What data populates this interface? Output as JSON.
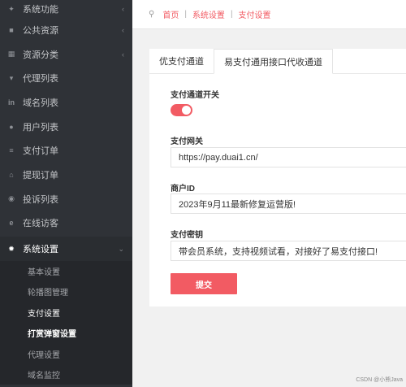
{
  "sidebar": {
    "items": [
      {
        "label": "系统功能",
        "icon": "gear-icon",
        "chevron": "‹"
      },
      {
        "label": "公共资源",
        "icon": "video-icon",
        "chevron": "‹"
      },
      {
        "label": "资源分类",
        "icon": "grid-icon",
        "chevron": "‹"
      },
      {
        "label": "代理列表",
        "icon": "shirt-icon",
        "chevron": ""
      },
      {
        "label": "域名列表",
        "icon": "linkedin-icon",
        "chevron": ""
      },
      {
        "label": "用户列表",
        "icon": "user-icon",
        "chevron": ""
      },
      {
        "label": "支付订单",
        "icon": "list-icon",
        "chevron": ""
      },
      {
        "label": "提现订单",
        "icon": "bank-icon",
        "chevron": ""
      },
      {
        "label": "投诉列表",
        "icon": "alert-icon",
        "chevron": ""
      },
      {
        "label": "在线访客",
        "icon": "ie-icon",
        "chevron": ""
      },
      {
        "label": "系统设置",
        "icon": "settings-icon",
        "chevron": "⌄"
      }
    ],
    "submenu": [
      {
        "label": "基本设置"
      },
      {
        "label": "轮播图管理"
      },
      {
        "label": "支付设置"
      },
      {
        "label": "打赏弹窗设置"
      },
      {
        "label": "代理设置"
      },
      {
        "label": "域名监控"
      }
    ]
  },
  "breadcrumb": {
    "home": "首页",
    "level1": "系统设置",
    "level2": "支付设置"
  },
  "tabs": [
    {
      "label": "优支付通道"
    },
    {
      "label": "易支付通用接口代收通道"
    }
  ],
  "form": {
    "switch_label": "支付通道开关",
    "switch_on": true,
    "gateway_label": "支付网关",
    "gateway_value": "https://pay.duai1.cn/",
    "merchant_label": "商户ID",
    "merchant_value": "2023年9月11最新修复运营版!",
    "key_label": "支付密钥",
    "key_value": "带会员系统，支持视频试看，对接好了易支付接口!",
    "submit_label": "提交"
  },
  "watermark": "CSDN @小熊Java",
  "colors": {
    "accent": "#f25b63",
    "sidebar_bg": "#2f3237",
    "submenu_bg": "#25272b"
  }
}
